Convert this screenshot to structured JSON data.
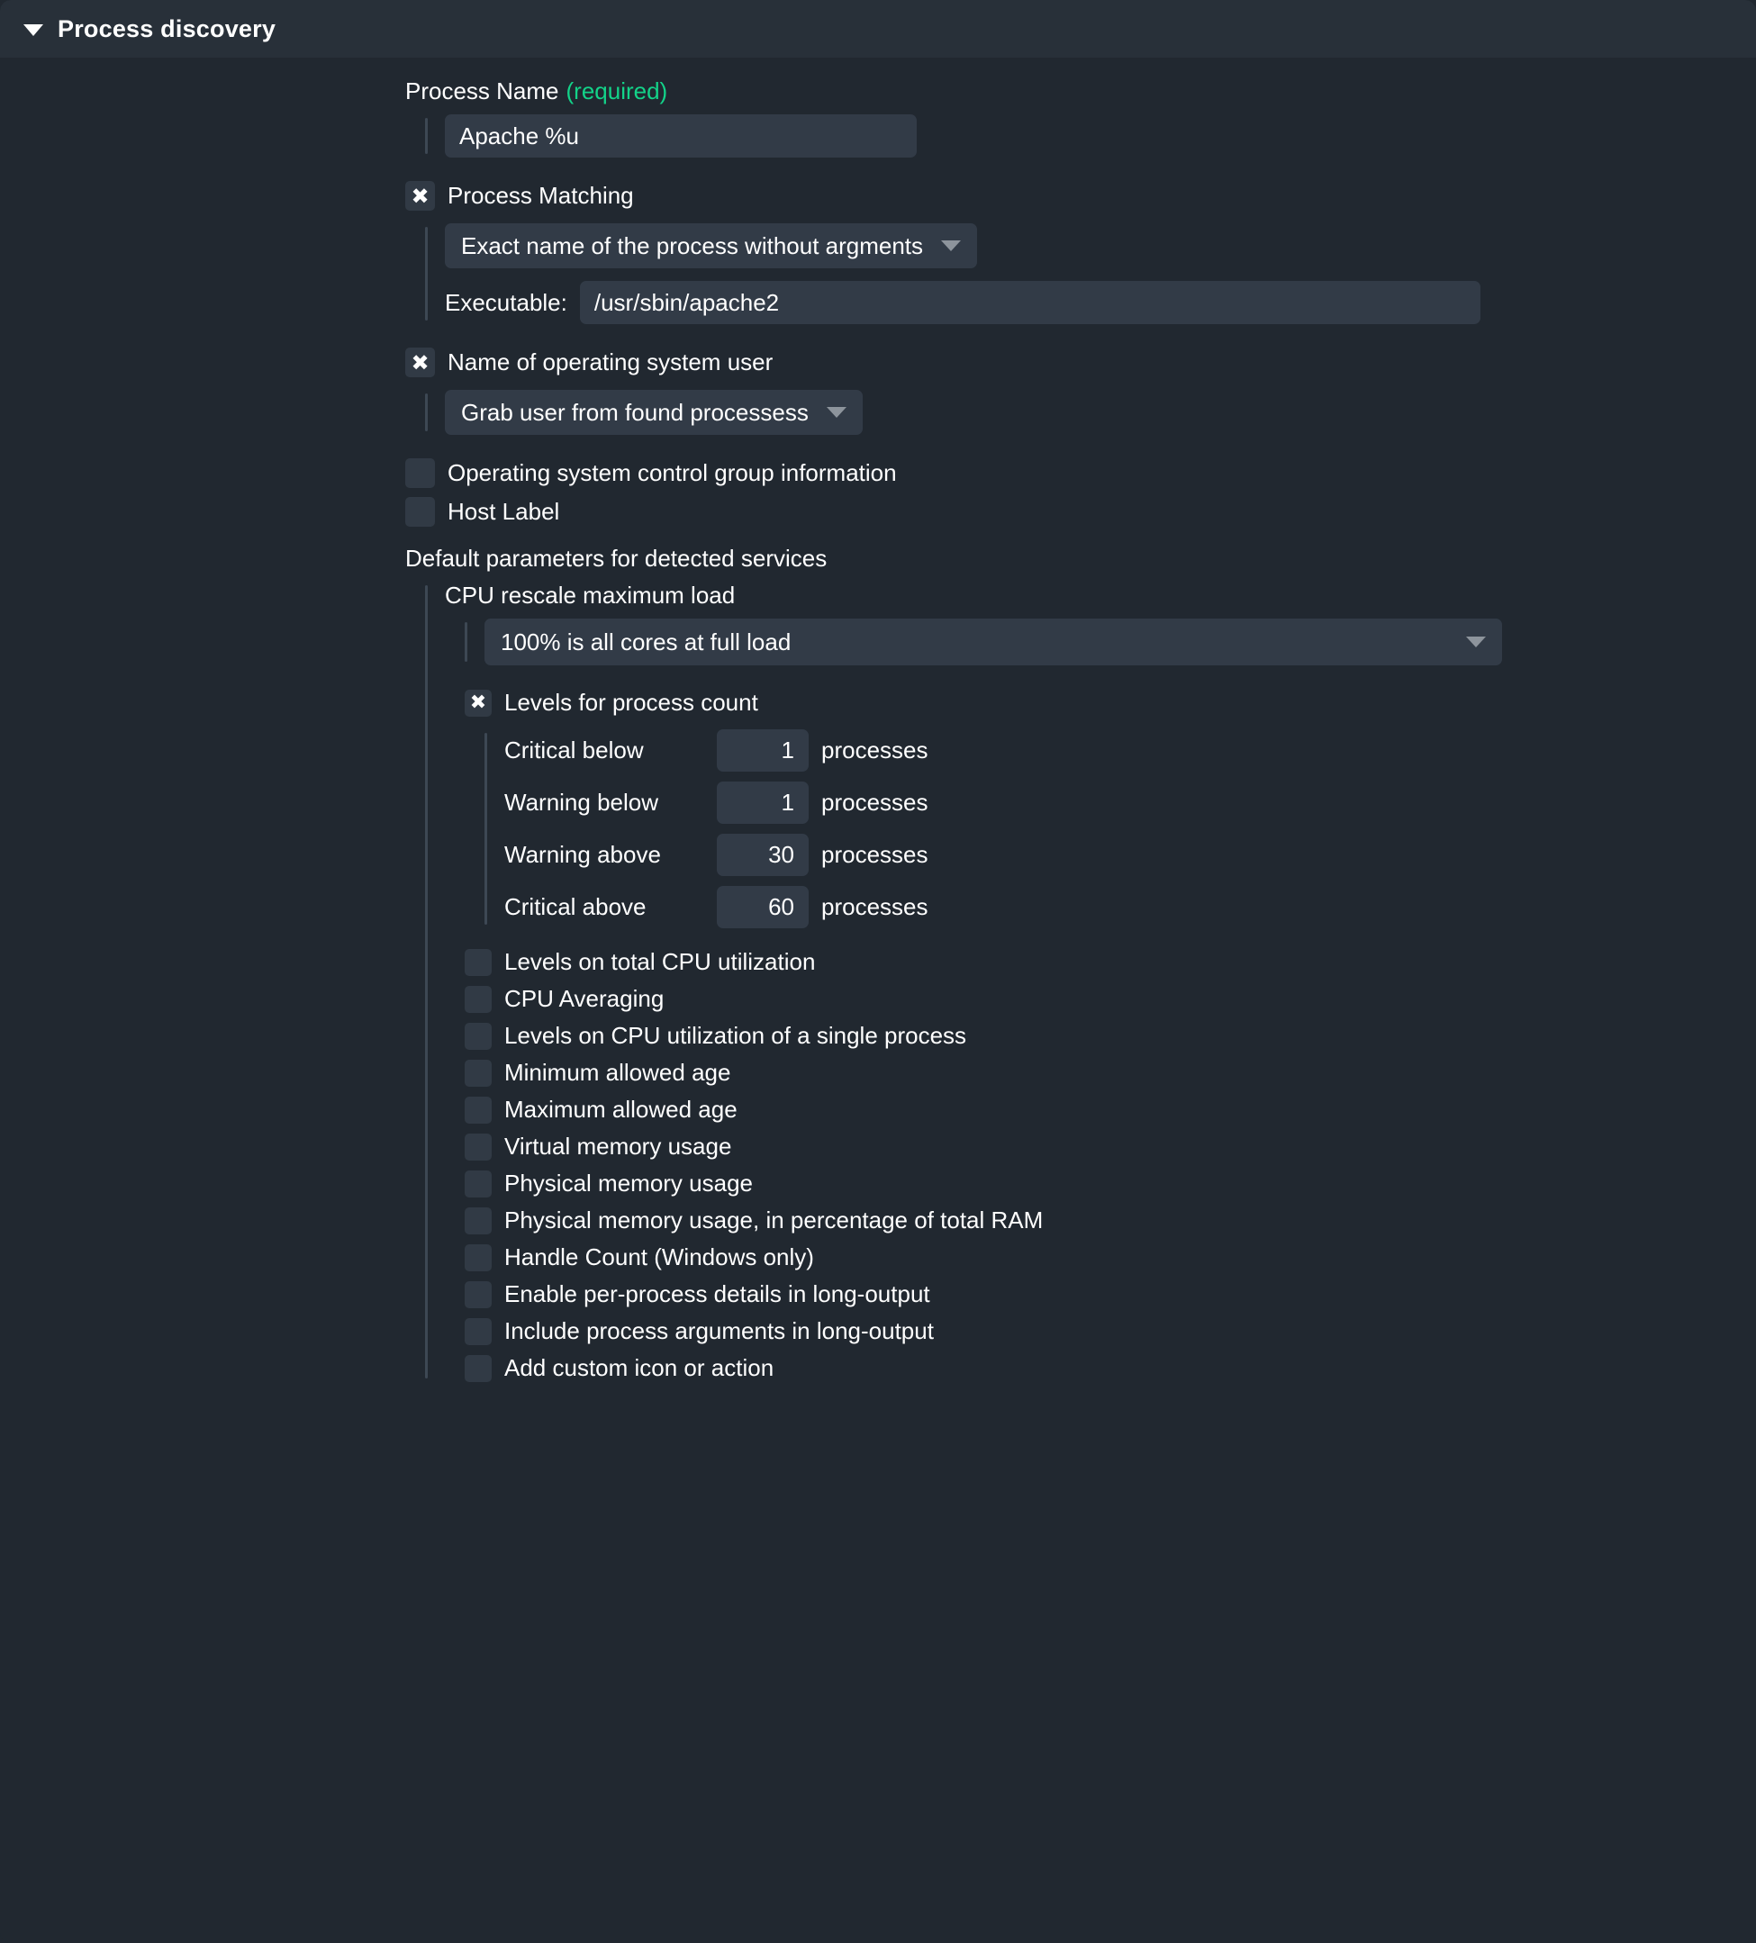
{
  "panel": {
    "title": "Process discovery",
    "expanded": true,
    "disclosure_icon": "triangle-down-icon"
  },
  "colors": {
    "panel_bg": "#212830",
    "header_bg": "#283039",
    "field_bg": "#323b47",
    "checkbox_bg": "#313a45",
    "rail": "#3d4854",
    "text": "#ffffff",
    "required_green": "#13d389",
    "arrow_gray": "#8d949c"
  },
  "process_name": {
    "label": "Process Name",
    "required_suffix": "(required)",
    "value": "Apache %u"
  },
  "process_matching": {
    "label": "Process Matching",
    "checked": true,
    "mode_value": "Exact name of the process without argments",
    "executable_label": "Executable:",
    "executable_value": "/usr/sbin/apache2"
  },
  "os_user": {
    "label": "Name of operating system user",
    "checked": true,
    "mode_value": "Grab user from found processess"
  },
  "cgroup": {
    "label": "Operating system control group information",
    "checked": false
  },
  "host_label": {
    "label": "Host Label",
    "checked": false
  },
  "defaults": {
    "heading": "Default parameters for detected services",
    "cpu_rescale": {
      "label": "CPU rescale maximum load",
      "value": "100% is all cores at full load"
    },
    "process_count": {
      "label": "Levels for process count",
      "checked": true,
      "unit": "processes",
      "levels": [
        {
          "label": "Critical below",
          "value": "1"
        },
        {
          "label": "Warning below",
          "value": "1"
        },
        {
          "label": "Warning above",
          "value": "30"
        },
        {
          "label": "Critical above",
          "value": "60"
        }
      ]
    },
    "options": [
      {
        "label": "Levels on total CPU utilization",
        "checked": false
      },
      {
        "label": "CPU Averaging",
        "checked": false
      },
      {
        "label": "Levels on CPU utilization of a single process",
        "checked": false
      },
      {
        "label": "Minimum allowed age",
        "checked": false
      },
      {
        "label": "Maximum allowed age",
        "checked": false
      },
      {
        "label": "Virtual memory usage",
        "checked": false
      },
      {
        "label": "Physical memory usage",
        "checked": false
      },
      {
        "label": "Physical memory usage, in percentage of total RAM",
        "checked": false
      },
      {
        "label": "Handle Count (Windows only)",
        "checked": false
      },
      {
        "label": "Enable per-process details in long-output",
        "checked": false
      },
      {
        "label": "Include process arguments in long-output",
        "checked": false
      },
      {
        "label": "Add custom icon or action",
        "checked": false
      }
    ]
  }
}
